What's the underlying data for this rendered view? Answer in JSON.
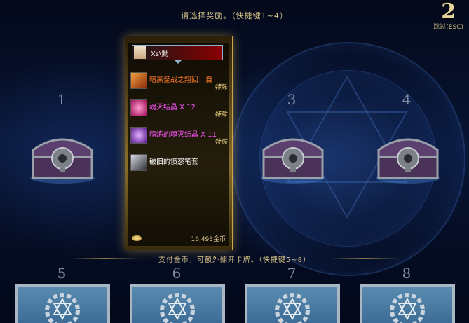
{
  "header": {
    "prompt": "请选择奖励。（快捷键1~4）"
  },
  "timer": {
    "count": "2",
    "skip_label": "跳过(ESC)"
  },
  "chests": [
    {
      "number": "1"
    },
    {
      "number": "3"
    },
    {
      "number": "4"
    }
  ],
  "player": {
    "name": "Xs\\勳"
  },
  "rewards": [
    {
      "name": "暗黑圣战之翔回：自",
      "tag": "特殊",
      "color": "#ff7a2a",
      "icon": "wing-icon"
    },
    {
      "name": "魂灭结晶 X 12",
      "tag": "特殊",
      "color": "#ff55ff",
      "icon": "crystal-icon"
    },
    {
      "name": "精炼的魂灭结晶 X 11",
      "tag": "特殊",
      "color": "#ff55ff",
      "icon": "refined-crystal-icon"
    },
    {
      "name": "破旧的愤怒笔套",
      "tag": "",
      "color": "#ffffff",
      "icon": "pen-icon"
    }
  ],
  "gold": {
    "amount": "16,493金币"
  },
  "footer": {
    "prompt": "支付金币，可额外翻开卡牌。（快捷键5~8）"
  },
  "cards": [
    {
      "number": "5"
    },
    {
      "number": "6"
    },
    {
      "number": "7"
    },
    {
      "number": "8"
    }
  ]
}
